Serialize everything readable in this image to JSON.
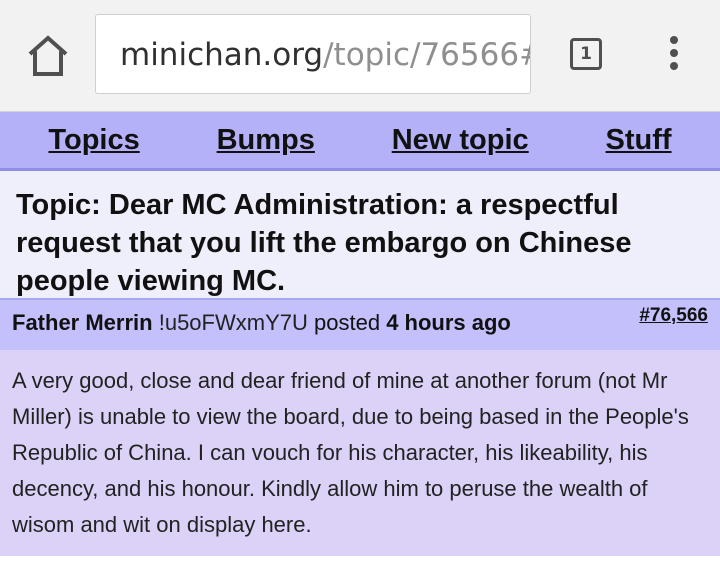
{
  "browser": {
    "url_host": "minichan.org",
    "url_path": "/topic/76566#",
    "tab_count": "1"
  },
  "nav": {
    "items": [
      "Topics",
      "Bumps",
      "New topic",
      "Stuff"
    ]
  },
  "topic": {
    "title": "Topic: Dear MC Administration: a respectful request that you lift the embargo on Chinese people viewing MC."
  },
  "post": {
    "author": "Father Merrin",
    "tripcode": "!u5oFWxmY7U",
    "posted_label": "posted",
    "time_ago": "4 hours ago",
    "post_id": "#76,566",
    "body": "A very good, close and dear friend of mine at another forum (not Mr Miller) is unable to view the board, due to being based in the People's Republic of China. I can vouch for his character, his likeability, his decency, and his honour. Kindly allow him to peruse the wealth of wisom and wit on display here."
  },
  "colors": {
    "nav_bg": "#b4b1f8",
    "topic_bg": "#efeefb",
    "post_header_bg": "#c3c0fb",
    "post_body_bg": "#dcd2f7"
  },
  "icons": {
    "home": "home-icon",
    "tabs": "tab-switcher-icon",
    "menu": "overflow-menu-icon"
  }
}
